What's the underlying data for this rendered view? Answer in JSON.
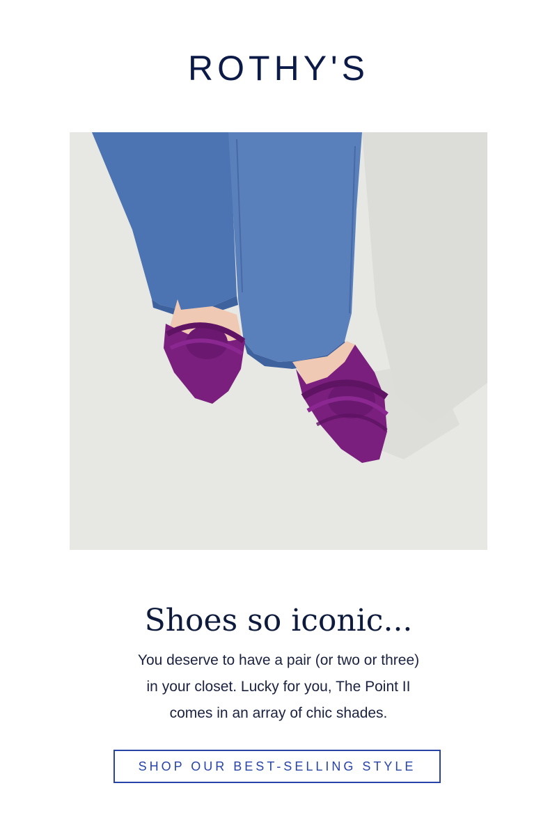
{
  "brand": {
    "logo_text": "ROTHY'S"
  },
  "hero": {
    "image_subject": "product-photo",
    "colors": {
      "background": "#e7e7e4",
      "denim": "#4a6fae",
      "shoe": "#7a1f7d"
    }
  },
  "content": {
    "headline": "Shoes so iconic...",
    "body_line_1": "You deserve to have a pair (or two or three)",
    "body_line_2": "in your closet. Lucky for you, The Point II",
    "body_line_3": "comes in an array of chic shades."
  },
  "cta": {
    "label": "SHOP OUR BEST-SELLING STYLE",
    "color": "#2743a8"
  }
}
